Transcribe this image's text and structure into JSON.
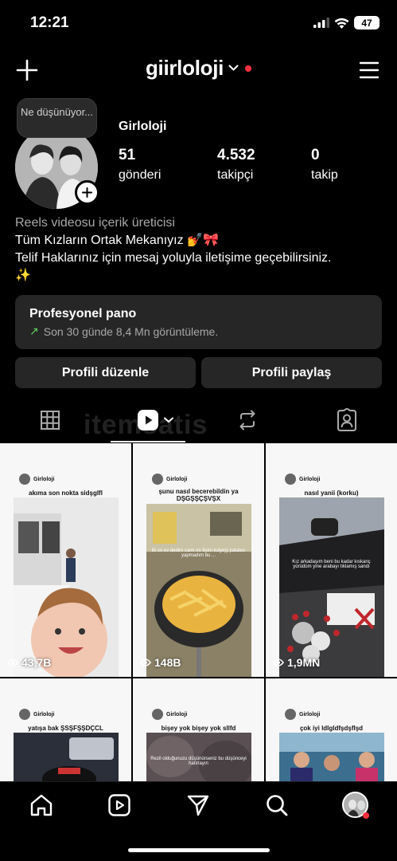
{
  "status": {
    "time": "12:21",
    "battery": "47"
  },
  "header": {
    "username": "giirloloji"
  },
  "profile": {
    "note": "Ne düşünüyor...",
    "display_name": "Girloloji",
    "stats": [
      {
        "value": "51",
        "label": "gönderi"
      },
      {
        "value": "4.532",
        "label": "takipçi"
      },
      {
        "value": "0",
        "label": "takip"
      }
    ],
    "bio": {
      "category": "Reels videosu içerik üreticisi",
      "line1": "Tüm Kızların Ortak Mekanıyız 💅🎀",
      "line2": "Telif Haklarınız için mesaj yoluyla iletişime geçebilirsiniz.",
      "line3": "✨"
    }
  },
  "dashboard": {
    "title": "Profesyonel pano",
    "subtitle": "Son 30 günde 8,4 Mn görüntüleme."
  },
  "buttons": {
    "edit": "Profili düzenle",
    "share": "Profili paylaş"
  },
  "watermark": "itemsatis",
  "grid": [
    {
      "user": "Girloloji",
      "caption": "akıma son nokta sidşglfl",
      "views": "43,7B",
      "overlay": ""
    },
    {
      "user": "Girloloji",
      "caption": "şunu nasıl becerebildin ya DŞGŞŞÇŞVŞX",
      "views": "148B",
      "overlay": "Bi sn ev dedim canlı mı fişim kulyejş patates yapmadım bu ..."
    },
    {
      "user": "Girloloji",
      "caption": "nasıl yanii (korku)",
      "views": "1,9MN",
      "overlay": "Kız arkadaşım beni bu kadar kıskanç yürüdüm yine arabayı tıklamış sandı"
    },
    {
      "user": "Girloloji",
      "caption": "yatışa bak ŞSŞFŞŞDÇCL",
      "views": "",
      "overlay": ""
    },
    {
      "user": "Girloloji",
      "caption": "bişey yok bişey yok sllfd",
      "views": "",
      "overlay": "Rezil olduğunuzu düşünürseniz bu düşünceyi hatırlayın"
    },
    {
      "user": "Girloloji",
      "caption": "çok iyi ldlgldfşdşflşd",
      "views": "",
      "overlay": ""
    }
  ],
  "colors": {
    "background": "#000000",
    "surface": "#262626",
    "accent_red": "#ff3040",
    "trend_green": "#5fd35f"
  }
}
